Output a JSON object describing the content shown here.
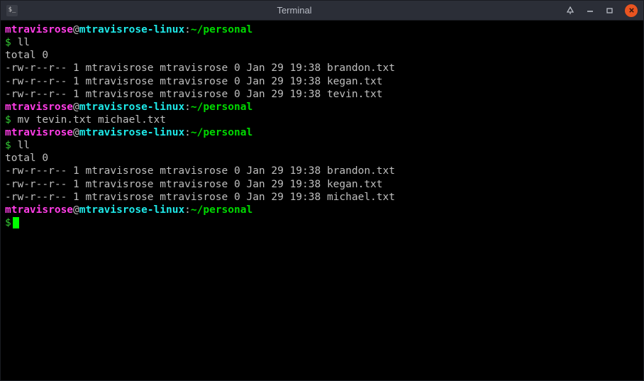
{
  "window": {
    "title": "Terminal",
    "app_icon_glyph": "$_"
  },
  "prompt": {
    "user": "mtravisrose",
    "at": "@",
    "host": "mtravisrose-linux",
    "colon": ":",
    "path": "~/personal",
    "symbol": "$"
  },
  "session": [
    {
      "type": "prompt"
    },
    {
      "type": "command",
      "text": "ll"
    },
    {
      "type": "output",
      "text": "total 0"
    },
    {
      "type": "output",
      "text": "-rw-r--r-- 1 mtravisrose mtravisrose 0 Jan 29 19:38 brandon.txt"
    },
    {
      "type": "output",
      "text": "-rw-r--r-- 1 mtravisrose mtravisrose 0 Jan 29 19:38 kegan.txt"
    },
    {
      "type": "output",
      "text": "-rw-r--r-- 1 mtravisrose mtravisrose 0 Jan 29 19:38 tevin.txt"
    },
    {
      "type": "prompt"
    },
    {
      "type": "command",
      "text": "mv tevin.txt michael.txt"
    },
    {
      "type": "prompt"
    },
    {
      "type": "command",
      "text": "ll"
    },
    {
      "type": "output",
      "text": "total 0"
    },
    {
      "type": "output",
      "text": "-rw-r--r-- 1 mtravisrose mtravisrose 0 Jan 29 19:38 brandon.txt"
    },
    {
      "type": "output",
      "text": "-rw-r--r-- 1 mtravisrose mtravisrose 0 Jan 29 19:38 kegan.txt"
    },
    {
      "type": "output",
      "text": "-rw-r--r-- 1 mtravisrose mtravisrose 0 Jan 29 19:38 michael.txt"
    },
    {
      "type": "prompt"
    },
    {
      "type": "cursor"
    }
  ]
}
